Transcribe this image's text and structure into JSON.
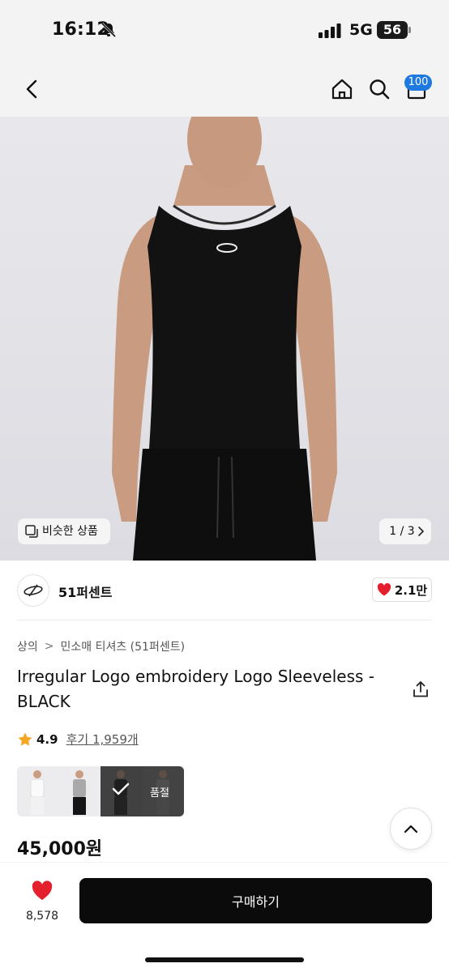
{
  "status_bar": {
    "time": "16:12",
    "network": "5G",
    "battery": "56"
  },
  "header": {
    "cart_count": "100"
  },
  "hero": {
    "similar_label": "비슷한 상품",
    "pager": "1 / 3"
  },
  "brand": {
    "name": "51퍼센트",
    "likes": "2.1만"
  },
  "breadcrumb": {
    "level1": "상의",
    "separator": ">",
    "level2": "민소매 티셔츠 (51퍼센트)"
  },
  "product": {
    "title": "Irregular Logo embroidery Logo Sleeveless - BLACK",
    "rating": "4.9",
    "reviews": "후기 1,959개",
    "price": "45,000원",
    "soldout_label": "품절"
  },
  "bottom_bar": {
    "wish_count": "8,578",
    "buy_label": "구매하기"
  },
  "colors": {
    "accent": "#1f7ae0",
    "heart": "#e5202e",
    "star": "#f5a623",
    "buy_bg": "#0b0b0b"
  }
}
